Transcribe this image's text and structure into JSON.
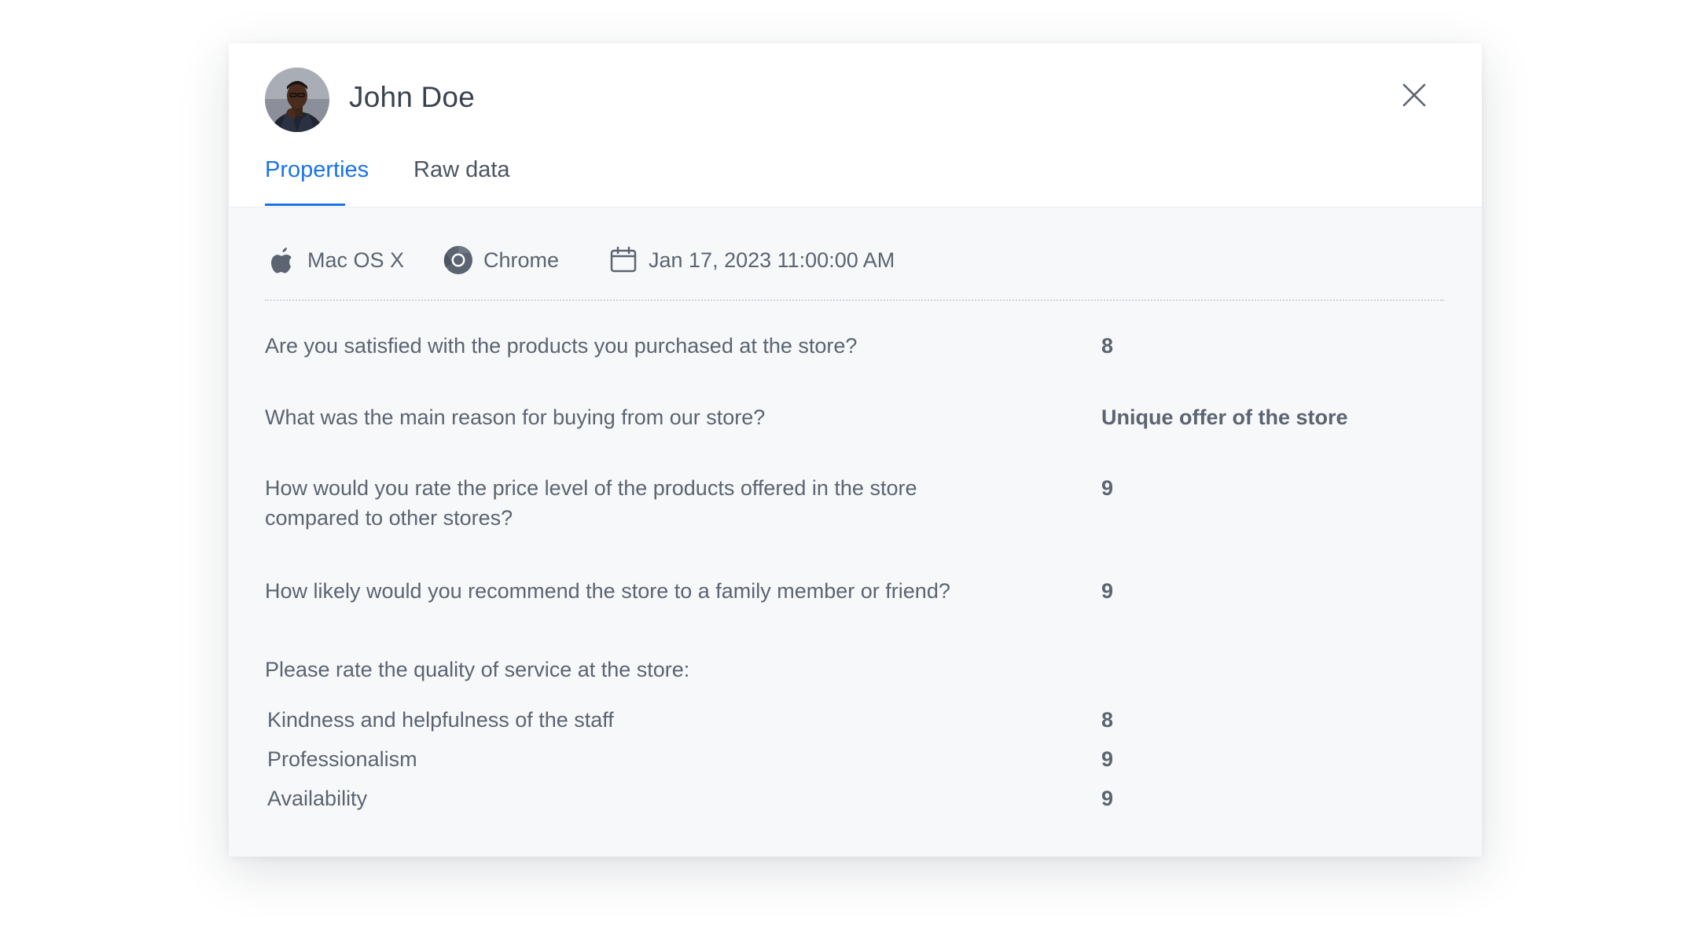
{
  "user": {
    "name": "John Doe",
    "avatar": "avatar-photo"
  },
  "tabs": [
    {
      "label": "Properties",
      "active": true
    },
    {
      "label": "Raw data",
      "active": false
    }
  ],
  "meta": {
    "os": {
      "icon": "apple-icon",
      "label": "Mac OS X"
    },
    "browser": {
      "icon": "chrome-icon",
      "label": "Chrome"
    },
    "date": {
      "icon": "calendar-icon",
      "label": "Jan 17, 2023 11:00:00 AM"
    }
  },
  "questions": [
    {
      "text": "Are you satisfied with the products you purchased at the store?",
      "answer": "8"
    },
    {
      "text": "What was the main reason for buying from our store?",
      "answer": "Unique offer of the store"
    },
    {
      "text": "How would you rate the price level of the products offered in the store compared to other stores?",
      "answer": "9"
    },
    {
      "text": "How likely would you recommend the store to a family member or friend?",
      "answer": "9"
    }
  ],
  "rating_question": {
    "text": "Please rate the quality of service at the store:",
    "items": [
      {
        "label": "Kindness and helpfulness of the staff",
        "value": "8"
      },
      {
        "label": "Professionalism",
        "value": "9"
      },
      {
        "label": "Availability",
        "value": "9"
      }
    ]
  },
  "colors": {
    "accent": "#1a73e8",
    "text": "#5b6470",
    "title": "#3a4250",
    "panel": "#f7f8fa"
  }
}
